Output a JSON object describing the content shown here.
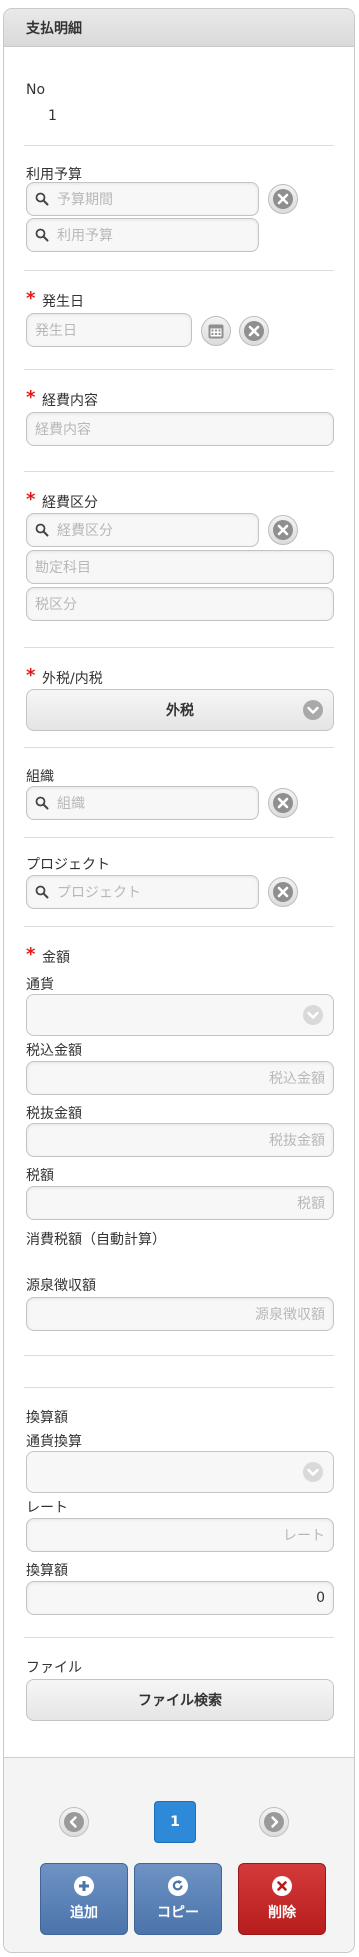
{
  "panel": {
    "title": "支払明細"
  },
  "no": {
    "label": "No",
    "value": "1"
  },
  "budget": {
    "label": "利用予算",
    "period_placeholder": "予算期間",
    "budget_placeholder": "利用予算"
  },
  "date": {
    "label": "発生日",
    "placeholder": "発生日"
  },
  "content": {
    "label": "経費内容",
    "placeholder": "経費内容"
  },
  "category": {
    "label": "経費区分",
    "placeholder": "経費区分",
    "account_placeholder": "勘定科目",
    "tax_placeholder": "税区分"
  },
  "tax_type": {
    "label": "外税/内税",
    "selected": "外税"
  },
  "org": {
    "label": "組織",
    "placeholder": "組織"
  },
  "project": {
    "label": "プロジェクト",
    "placeholder": "プロジェクト"
  },
  "amount": {
    "label": "金額",
    "currency_label": "通貨",
    "tax_incl_label": "税込金額",
    "tax_incl_placeholder": "税込金額",
    "tax_excl_label": "税抜金額",
    "tax_excl_placeholder": "税抜金額",
    "tax_label": "税額",
    "tax_placeholder": "税額",
    "auto_tax_label": "消費税額（自動計算）",
    "withholding_label": "源泉徴収額",
    "withholding_placeholder": "源泉徴収額"
  },
  "conversion": {
    "label": "換算額",
    "currency_label": "通貨換算",
    "rate_label": "レート",
    "rate_placeholder": "レート",
    "converted_label": "換算額",
    "converted_value": "0"
  },
  "file": {
    "label": "ファイル",
    "button": "ファイル検索"
  },
  "pager": {
    "current": "1"
  },
  "actions": {
    "add": "追加",
    "copy": "コピー",
    "delete": "削除"
  },
  "colors": {
    "required": "#e01a1a",
    "pager_active": "#2e89d8",
    "action_blue": "#5a80b6",
    "action_red": "#c52a2a"
  },
  "icons": [
    "search-icon",
    "clear-icon",
    "calendar-icon",
    "chevron-down-icon",
    "prev-icon",
    "next-icon",
    "plus-icon",
    "copy-icon",
    "close-icon"
  ]
}
